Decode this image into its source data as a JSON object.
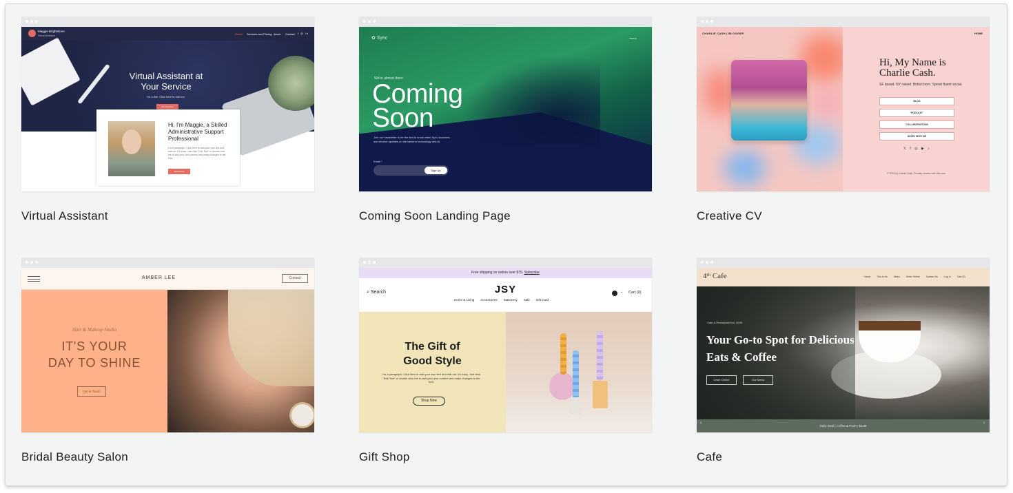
{
  "templates": [
    {
      "title": "Virtual Assistant",
      "preview": {
        "brand": "Maggie Brightstone",
        "brand_sub": "Virtual Assistant",
        "nav": [
          "Home",
          "Services and Pricing",
          "About",
          "Contact"
        ],
        "hero_title": "Virtual Assistant at Your Service",
        "hero_sub": "I'm a title. Click here to edit me.",
        "hero_button": "Get Services",
        "card_title": "Hi, I'm Maggie, a Skilled Administrative Support Professional",
        "card_text": "I'm a paragraph. Click here to add your own text and edit me. It's easy. Just click \"Edit Text\" or double click me to add your own content and make changes to the font.",
        "card_button": "Read More"
      }
    },
    {
      "title": "Coming Soon Landing Page",
      "preview": {
        "logo": "Sync",
        "nav_home": "Home",
        "kicker": "We're almost there",
        "headline": "Coming Soon",
        "paragraph": "Join our newsletter to be the first to know when Sync launches and receive updates on the latest in technology and AI.",
        "email_label": "Email *",
        "signup": "Sign Up"
      }
    },
    {
      "title": "Creative CV",
      "preview": {
        "header": "CHARLIE CASH | BLOGGER",
        "nav_home": "HOME",
        "headline": "Hi, My Name is Charlie Cash.",
        "sub": "SF based. NY raised. British born. Speak fluent social.",
        "buttons": [
          "BLOG",
          "PODCAST",
          "COLLABORATIONS",
          "WORK WITH ME"
        ],
        "social": "𝕏 f ◎ ▶ ♪",
        "footer": "© 2023 by Charlie Cash. Proudly created with Wix.com"
      }
    },
    {
      "title": "Bridal Beauty Salon",
      "preview": {
        "brand": "AMBER LEE",
        "contact": "Contact",
        "studio": "Hair & Makeup Studio",
        "headline": "IT'S YOUR DAY TO SHINE",
        "button": "Get in Touch"
      }
    },
    {
      "title": "Gift Shop",
      "preview": {
        "promo": "Free shipping on orders over $75.",
        "promo_link": "Subscribe",
        "search": "Search",
        "logo": "JSY",
        "nav": [
          "Home & Living",
          "Accessories",
          "Stationery",
          "Sale",
          "Gift Card"
        ],
        "cart": "Cart (0)",
        "headline": "The Gift of Good Style",
        "paragraph": "I'm a paragraph. Click here to add your own text and edit me. It's easy. Just click \"Edit Text\" or double click me to add your own content and make changes to the font.",
        "button": "Shop Now"
      }
    },
    {
      "title": "Cafe",
      "preview": {
        "logo": "4ᵗʰ Cafe",
        "nav": [
          "Home",
          "This Is Us",
          "Menu",
          "Order Online",
          "Contact Us",
          "Log In",
          "Cart (0)"
        ],
        "kicker": "Cafe & Restaurant Est. 2035",
        "headline": "Your Go-to Spot for Delicious Eats & Coffee",
        "buttons": [
          "Order Online",
          "Our Menu"
        ],
        "footer": "Daily Deal  |  Coffee & Pastry $3.99"
      }
    }
  ]
}
